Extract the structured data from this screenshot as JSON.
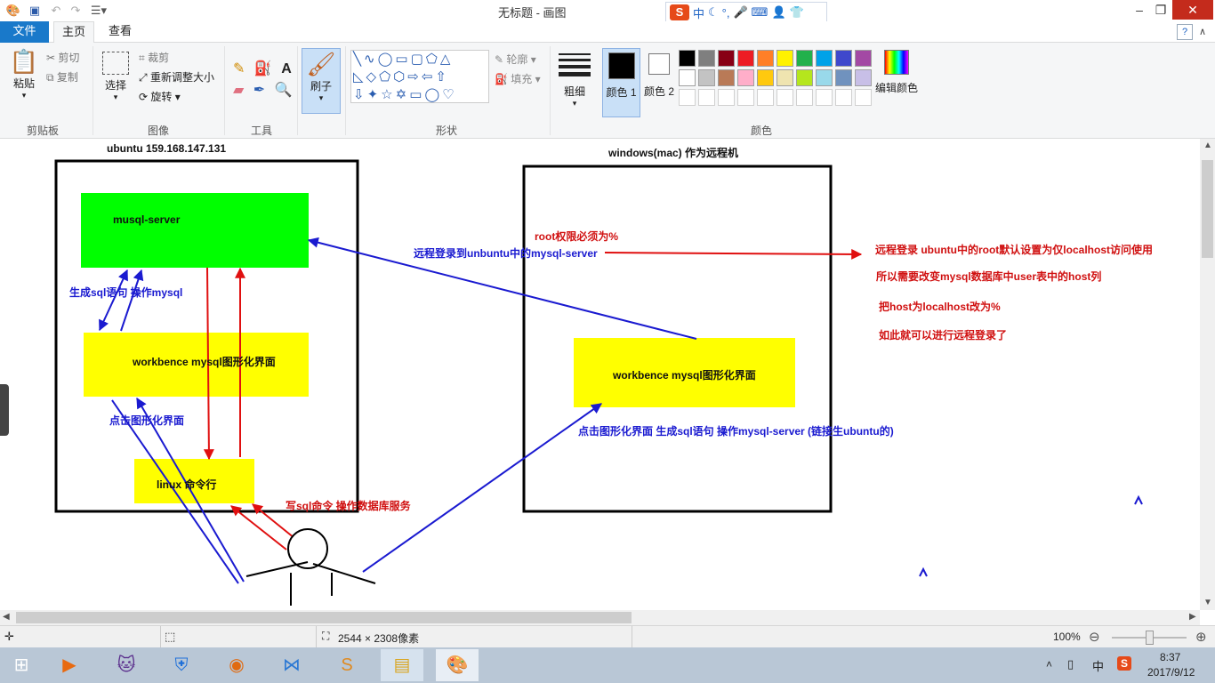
{
  "window": {
    "title": "无标题 - 画图",
    "minimize": "–",
    "restore": "❐",
    "close": "✕"
  },
  "ime": {
    "logo": "S",
    "items": [
      "中",
      "☾",
      "°,",
      "🎤",
      "⌨",
      "👤",
      "👕"
    ]
  },
  "tabs": {
    "file": "文件",
    "home": "主页",
    "view": "查看",
    "help": "?",
    "collapse": "∧"
  },
  "ribbon": {
    "clipboard": {
      "paste": "粘贴",
      "cut": "剪切",
      "copy": "复制",
      "label": "剪贴板"
    },
    "image": {
      "select": "选择",
      "crop": "裁剪",
      "resize": "重新调整大小",
      "rotate": "旋转",
      "label": "图像"
    },
    "tools": {
      "label": "工具"
    },
    "brush": {
      "label": "刷子"
    },
    "shapes": {
      "outline": "轮廓",
      "fill": "填充",
      "label": "形状"
    },
    "size": {
      "label": "粗细"
    },
    "colors": {
      "color1": "颜色 1",
      "color2": "颜色 2",
      "edit": "编辑颜色",
      "label": "颜色",
      "color1_value": "#000000",
      "color2_value": "#ffffff",
      "row1": [
        "#000000",
        "#7f7f7f",
        "#880015",
        "#ed1c24",
        "#ff7f27",
        "#fff200",
        "#22b14c",
        "#00a2e8",
        "#3f48cc",
        "#a349a4"
      ],
      "row2": [
        "#ffffff",
        "#c3c3c3",
        "#b97a57",
        "#ffaec9",
        "#ffc90e",
        "#efe4b0",
        "#b5e61d",
        "#99d9ea",
        "#7092be",
        "#c8bfe7"
      ],
      "row3": [
        "#ffffff",
        "#ffffff",
        "#ffffff",
        "#ffffff",
        "#ffffff",
        "#ffffff",
        "#ffffff",
        "#ffffff",
        "#ffffff",
        "#ffffff"
      ]
    }
  },
  "drawing": {
    "ubuntu_title": "ubuntu  159.168.147.131",
    "windows_title": "windows(mac)  作为远程机",
    "mysql_server": "musql-server",
    "workbench_left": "workbence mysql图形化界面",
    "linux_cmd": "linux 命令行",
    "gen_sql": "生成sql语句 操作mysql",
    "click_gui_left": "点击图形化界面",
    "write_sql": "写sql命令 操作数据库服务",
    "remote_login": "远程登录到unbuntu中的mysql-server",
    "root_perm": "root权限必须为%",
    "workbench_right": "workbence  mysql图形化界面",
    "click_gui_right": "点击图形化界面    生成sql语句   操作mysql-server  (链接生ubuntu的)",
    "note1": "远程登录 ubuntu中的root默认设置为仅localhost访问使用",
    "note2": "所以需要改变mysql数据库中user表中的host列",
    "note3": "把host为localhost改为%",
    "note4": "如此就可以进行远程登录了"
  },
  "status": {
    "dimensions": "2544 × 2308像素",
    "zoom": "100%",
    "minus": "⊖",
    "plus": "⊕"
  },
  "taskbar": {
    "time": "8:37",
    "date": "2017/9/12",
    "ime": "中",
    "sogou": "S"
  },
  "accent_colors": {
    "file_tab": "#1979ca",
    "close": "#c42b1c",
    "green_box": "#00ff00",
    "yellow_box": "#ffff00"
  }
}
